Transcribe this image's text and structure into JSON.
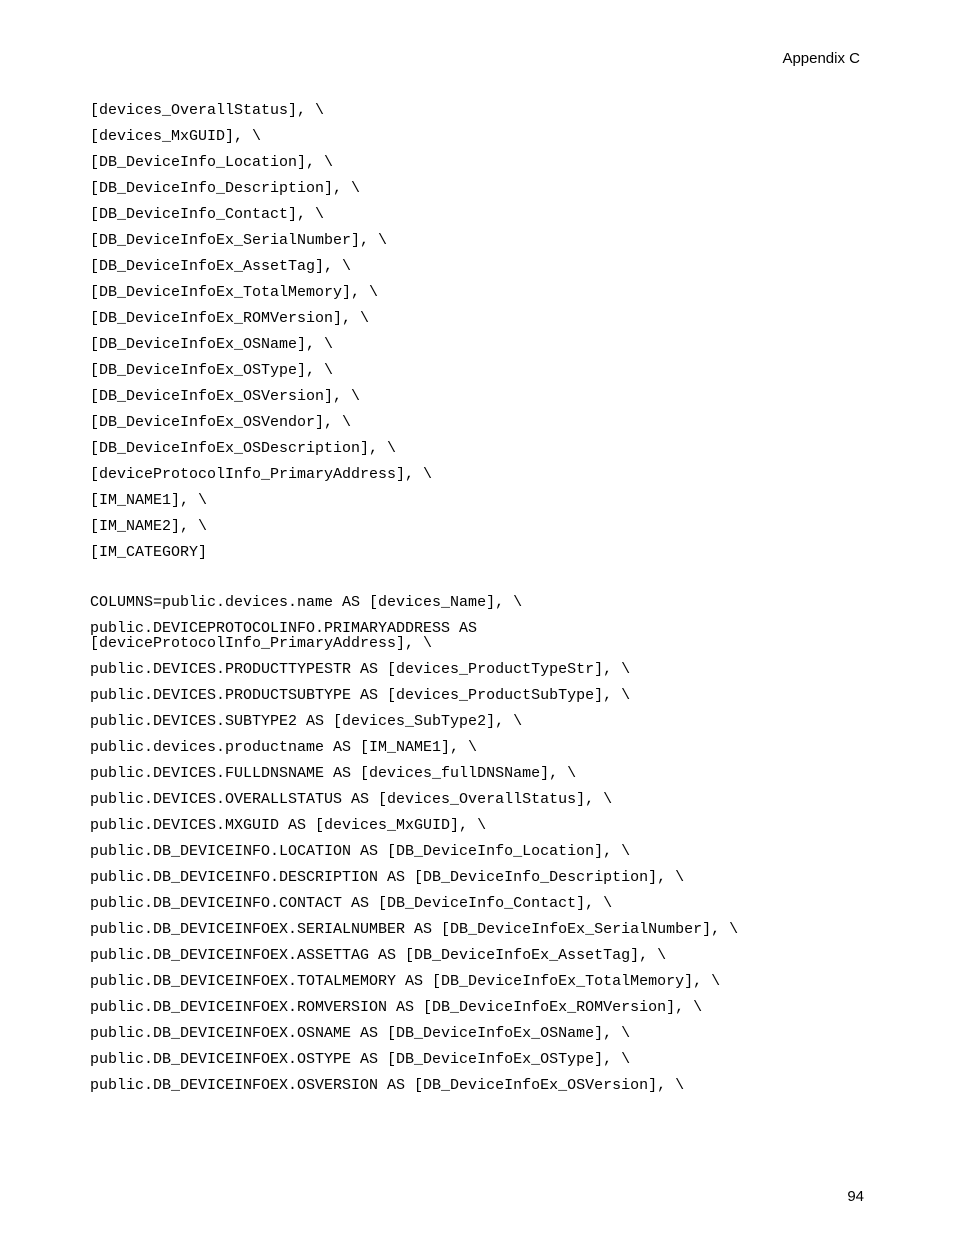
{
  "header": "Appendix C",
  "page_number": "94",
  "code_lines": [
    "[devices_OverallStatus], \\",
    "[devices_MxGUID], \\",
    "[DB_DeviceInfo_Location], \\",
    "[DB_DeviceInfo_Description], \\",
    "[DB_DeviceInfo_Contact], \\",
    "[DB_DeviceInfoEx_SerialNumber], \\",
    "[DB_DeviceInfoEx_AssetTag], \\",
    "[DB_DeviceInfoEx_TotalMemory], \\",
    "[DB_DeviceInfoEx_ROMVersion], \\",
    "[DB_DeviceInfoEx_OSName], \\",
    "[DB_DeviceInfoEx_OSType], \\",
    "[DB_DeviceInfoEx_OSVersion], \\",
    "[DB_DeviceInfoEx_OSVendor], \\",
    "[DB_DeviceInfoEx_OSDescription], \\",
    "[deviceProtocolInfo_PrimaryAddress], \\",
    "[IM_NAME1], \\",
    "[IM_NAME2], \\",
    "[IM_CATEGORY]",
    "",
    "COLUMNS=public.devices.name AS [devices_Name], \\",
    "public.DEVICEPROTOCOLINFO.PRIMARYADDRESS AS\n[deviceProtocolInfo_PrimaryAddress], \\",
    "public.DEVICES.PRODUCTTYPESTR AS [devices_ProductTypeStr], \\",
    "public.DEVICES.PRODUCTSUBTYPE AS [devices_ProductSubType], \\",
    "public.DEVICES.SUBTYPE2 AS [devices_SubType2], \\",
    "public.devices.productname AS [IM_NAME1], \\",
    "public.DEVICES.FULLDNSNAME AS [devices_fullDNSName], \\",
    "public.DEVICES.OVERALLSTATUS AS [devices_OverallStatus], \\",
    "public.DEVICES.MXGUID AS [devices_MxGUID], \\",
    "public.DB_DEVICEINFO.LOCATION AS [DB_DeviceInfo_Location], \\",
    "public.DB_DEVICEINFO.DESCRIPTION AS [DB_DeviceInfo_Description], \\",
    "public.DB_DEVICEINFO.CONTACT AS [DB_DeviceInfo_Contact], \\",
    "public.DB_DEVICEINFOEX.SERIALNUMBER AS [DB_DeviceInfoEx_SerialNumber], \\",
    "public.DB_DEVICEINFOEX.ASSETTAG AS [DB_DeviceInfoEx_AssetTag], \\",
    "public.DB_DEVICEINFOEX.TOTALMEMORY AS [DB_DeviceInfoEx_TotalMemory], \\",
    "public.DB_DEVICEINFOEX.ROMVERSION AS [DB_DeviceInfoEx_ROMVersion], \\",
    "public.DB_DEVICEINFOEX.OSNAME AS [DB_DeviceInfoEx_OSName], \\",
    "public.DB_DEVICEINFOEX.OSTYPE AS [DB_DeviceInfoEx_OSType], \\",
    "public.DB_DEVICEINFOEX.OSVERSION AS [DB_DeviceInfoEx_OSVersion], \\"
  ]
}
